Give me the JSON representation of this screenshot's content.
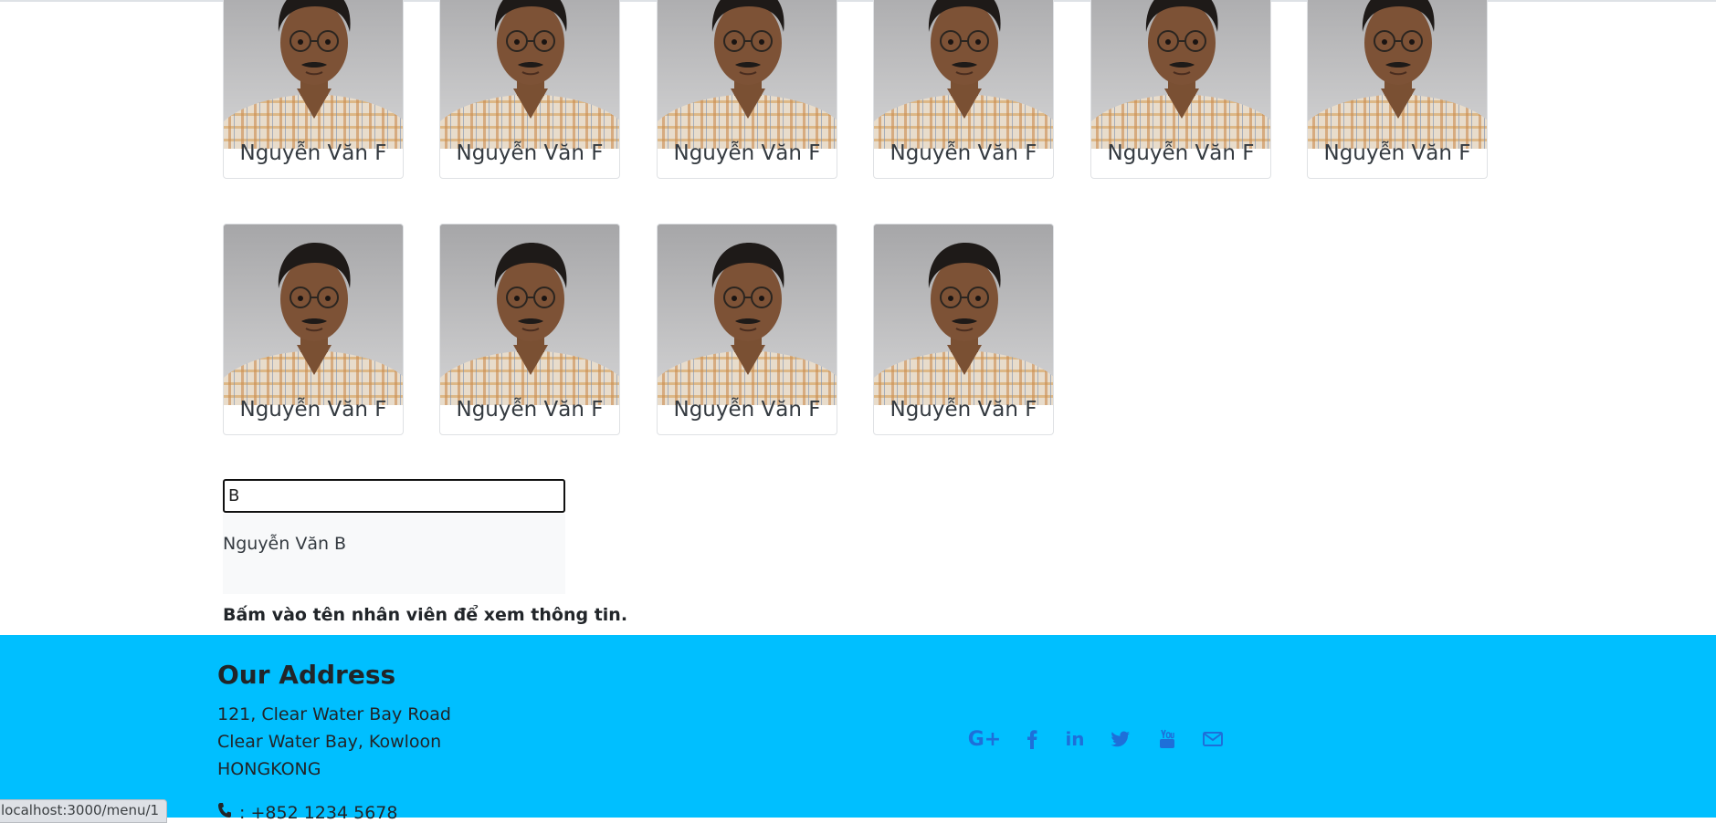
{
  "employees": [
    {
      "name": "Nguyễn Văn F"
    },
    {
      "name": "Nguyễn Văn F"
    },
    {
      "name": "Nguyễn Văn F"
    },
    {
      "name": "Nguyễn Văn F"
    },
    {
      "name": "Nguyễn Văn F"
    },
    {
      "name": "Nguyễn Văn F"
    },
    {
      "name": "Nguyễn Văn F"
    },
    {
      "name": "Nguyễn Văn F"
    },
    {
      "name": "Nguyễn Văn F"
    },
    {
      "name": "Nguyễn Văn F"
    }
  ],
  "search": {
    "value": "B",
    "suggestion": "Nguyễn Văn B",
    "hint": "Bấm vào tên nhân viên để xem thông tin."
  },
  "footer": {
    "title": "Our Address",
    "address_lines": [
      "121, Clear Water Bay Road",
      "Clear Water Bay, Kowloon",
      "HONGKONG"
    ],
    "phone": ": +852 1234 5678",
    "social_icons": [
      "google-plus-icon",
      "facebook-icon",
      "linkedin-icon",
      "twitter-icon",
      "youtube-icon",
      "mail-icon"
    ],
    "background_color": "#00bfff",
    "icon_color": "#1e6fd9"
  },
  "status_bar": {
    "url": "localhost:3000/menu/1"
  }
}
